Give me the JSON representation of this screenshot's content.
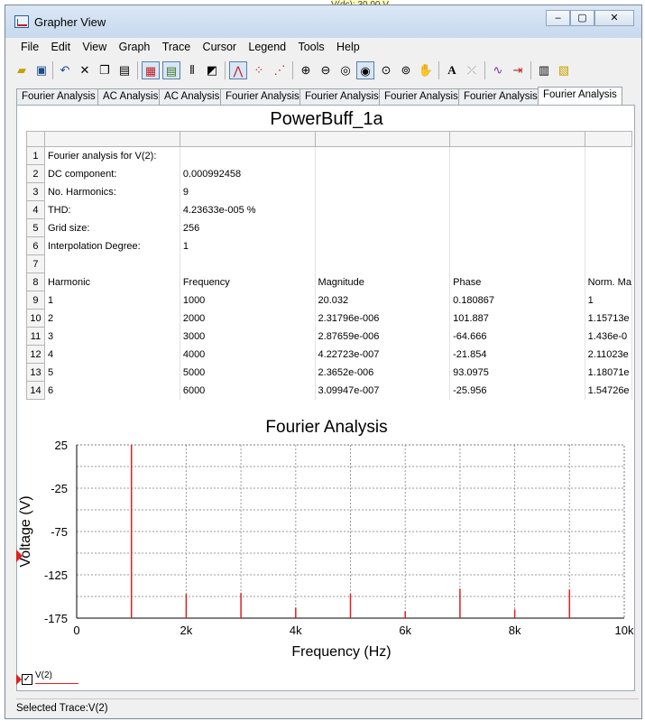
{
  "window": {
    "title": "Grapher View"
  },
  "menu": [
    "File",
    "Edit",
    "View",
    "Graph",
    "Trace",
    "Cursor",
    "Legend",
    "Tools",
    "Help"
  ],
  "tabs": [
    "Fourier Analysis",
    "AC Analysis",
    "AC Analysis",
    "Fourier Analysis",
    "Fourier Analysis",
    "Fourier Analysis",
    "Fourier Analysis",
    "Fourier Analysis"
  ],
  "active_tab": 7,
  "grid": {
    "title": "PowerBuff_1a",
    "row_numbers": [
      "1",
      "2",
      "3",
      "4",
      "5",
      "6",
      "7",
      "8",
      "9",
      "10",
      "11",
      "12",
      "13",
      "14"
    ],
    "rows": [
      [
        "Fourier analysis for V(2):",
        "",
        "",
        "",
        ""
      ],
      [
        "DC component:",
        "0.000992458",
        "",
        "",
        ""
      ],
      [
        "No. Harmonics:",
        "9",
        "",
        "",
        ""
      ],
      [
        "THD:",
        "4.23633e-005 %",
        "",
        "",
        ""
      ],
      [
        "Grid size:",
        "256",
        "",
        "",
        ""
      ],
      [
        "Interpolation Degree:",
        "1",
        "",
        "",
        ""
      ],
      [
        "",
        "",
        "",
        "",
        ""
      ],
      [
        "Harmonic",
        "Frequency",
        "Magnitude",
        "Phase",
        "Norm. Ma"
      ],
      [
        "1",
        "1000",
        "20.032",
        "0.180867",
        "1"
      ],
      [
        "2",
        "2000",
        "2.31796e-006",
        "101.887",
        "1.15713e"
      ],
      [
        "3",
        "3000",
        "2.87659e-006",
        "-64.666",
        "1.436e-0"
      ],
      [
        "4",
        "4000",
        "4.22723e-007",
        "-21.854",
        "2.11023e"
      ],
      [
        "5",
        "5000",
        "2.3652e-006",
        "93.0975",
        "1.18071e"
      ],
      [
        "6",
        "6000",
        "3.09947e-007",
        "-25.956",
        "1.54726e"
      ]
    ]
  },
  "chart_data": {
    "type": "bar",
    "title": "Fourier Analysis",
    "xlabel": "Frequency (Hz)",
    "ylabel": "Voltage (V)",
    "xlim": [
      0,
      10000
    ],
    "ylim": [
      -175,
      25
    ],
    "x_ticks": [
      0,
      2000,
      4000,
      6000,
      8000,
      10000
    ],
    "x_tick_labels": [
      "0",
      "2k",
      "4k",
      "6k",
      "8k",
      "10k"
    ],
    "y_ticks": [
      25,
      -25,
      -75,
      -125,
      -175
    ],
    "y_tick_labels": [
      "25",
      "-25",
      "-75",
      "-125",
      "-175"
    ],
    "grid": true,
    "series": [
      {
        "name": "V(2)",
        "color": "#e02020",
        "x": [
          1000,
          2000,
          3000,
          4000,
          5000,
          6000,
          7000,
          8000,
          9000
        ],
        "y": [
          26,
          -147,
          -146,
          -163,
          -147,
          -167,
          -141,
          -165,
          -142
        ]
      }
    ]
  },
  "legend": {
    "label": "V(2)",
    "checked": "✓"
  },
  "status": {
    "text": "Selected Trace:V(2)"
  },
  "background_fragments": [
    "V(dc): 30.00 V"
  ]
}
